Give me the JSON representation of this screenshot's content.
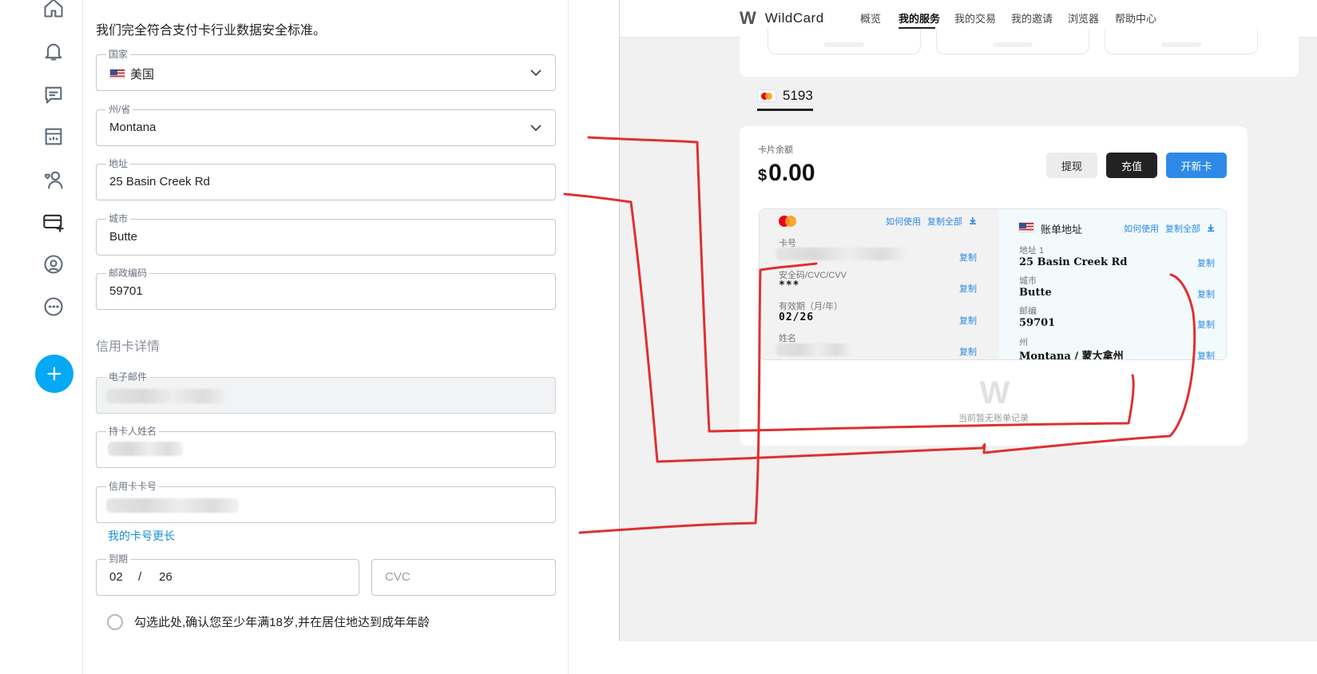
{
  "sidebar": {
    "icons": [
      "home-icon",
      "bell-icon",
      "chat-icon",
      "store-icon",
      "people-heart-icon",
      "add-card-icon",
      "coin-icon",
      "more-icon"
    ],
    "fab_icon": "plus-icon"
  },
  "form": {
    "pci_note": "我们完全符合支付卡行业数据安全标准。",
    "country": {
      "label": "国家",
      "value": "美国"
    },
    "state": {
      "label": "州/省",
      "value": "Montana"
    },
    "address": {
      "label": "地址",
      "value": "25 Basin Creek Rd"
    },
    "city": {
      "label": "城市",
      "value": "Butte"
    },
    "zip": {
      "label": "邮政编码",
      "value": "59701"
    },
    "credit_title": "信用卡详情",
    "email": {
      "label": "电子邮件"
    },
    "holder": {
      "label": "持卡人姓名"
    },
    "card_number": {
      "label": "信用卡卡号"
    },
    "longer_link": "我的卡号更长",
    "expiry": {
      "label": "到期",
      "month": "02",
      "sep": "/",
      "year": "26"
    },
    "cvc": {
      "placeholder": "CVC"
    },
    "age_confirm": "勾选此处,确认您至少年满18岁,并在居住地达到成年年龄"
  },
  "wildcard": {
    "logo": "W",
    "brand": "WildCard",
    "nav": [
      "概览",
      "我的服务",
      "我的交易",
      "我的邀请",
      "浏览器",
      "帮助中心"
    ],
    "active_nav": "我的服务",
    "card_tab_number": "5193",
    "balance_label": "卡片余额",
    "balance_currency": "$",
    "balance_amount": "0.00",
    "buttons": {
      "withdraw": "提现",
      "topup": "充值",
      "new_card": "开新卡"
    },
    "card_info": {
      "how_to_use": "如何使用",
      "copy_all": "复制全部",
      "card_number_label": "卡号",
      "cvc_label": "安全码/CVC/CVV",
      "cvc_value": "***",
      "expiry_label": "有效期（月/年）",
      "expiry_value": "02/26",
      "name_label": "姓名",
      "copy": "复制"
    },
    "billing": {
      "title": "账单地址",
      "how_to_use": "如何使用",
      "copy_all": "复制全部",
      "address1_label": "地址 1",
      "address1_value": "25 Basin Creek Rd",
      "city_label": "城市",
      "city_value": "Butte",
      "zip_label": "邮编",
      "zip_value": "59701",
      "state_label": "州",
      "state_value": "Montana / 蒙大拿州",
      "copy": "复制"
    },
    "empty_logo": "W",
    "empty_text": "当前暂无账单记录"
  },
  "annotation_color": "#e03030"
}
